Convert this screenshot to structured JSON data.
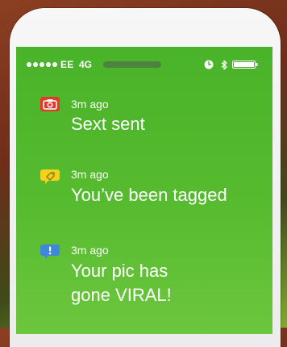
{
  "status_bar": {
    "signal_dots": 5,
    "carrier": "EE",
    "network": "4G"
  },
  "notifications": [
    {
      "icon": "camera-icon",
      "icon_color": "#e43a2b",
      "time": "3m ago",
      "message": "Sext sent"
    },
    {
      "icon": "tag-icon",
      "icon_color": "#f2d21d",
      "time": "3m ago",
      "message": "You’ve been tagged"
    },
    {
      "icon": "exclamation-icon",
      "icon_color": "#3f87d9",
      "time": "3m ago",
      "message_lines": [
        "Your pic has",
        "gone VIRAL!"
      ]
    }
  ],
  "colors": {
    "screen_green": "#4eb52d",
    "text": "#ffffff"
  }
}
